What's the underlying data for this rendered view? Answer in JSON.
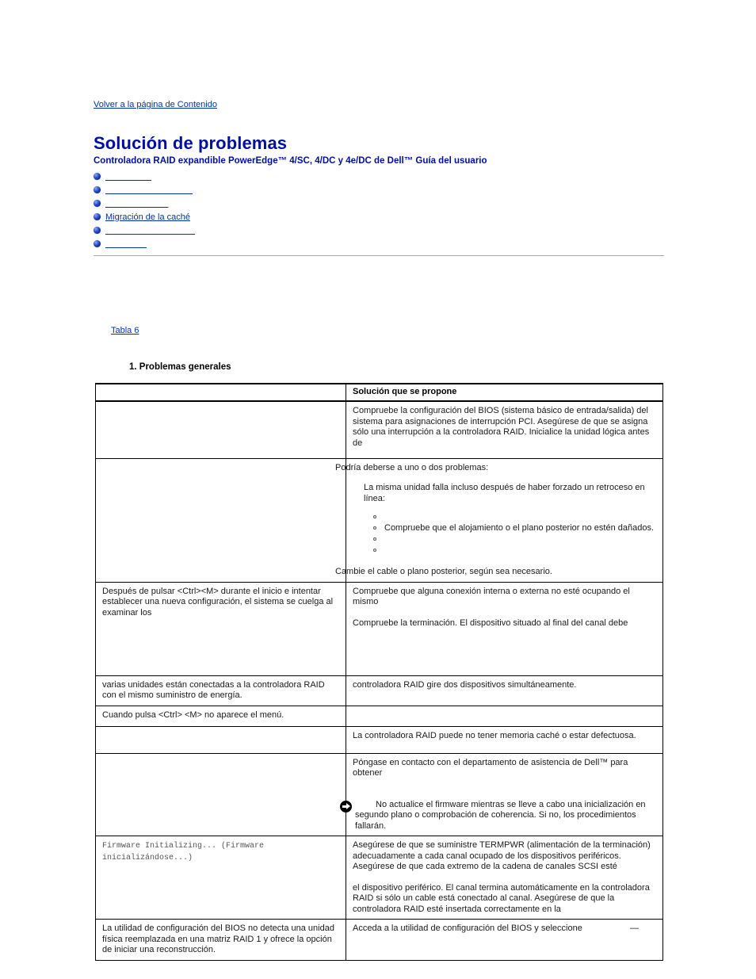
{
  "back_link": "Volver a la página de Contenido",
  "title": "Solución de problemas",
  "subtitle": "Controladora RAID expandible PowerEdge™ 4/SC, 4/DC y 4e/DC de Dell™ Guía del usuario",
  "toc": [
    {
      "label": "                   "
    },
    {
      "label": "                                    "
    },
    {
      "label": "                          "
    },
    {
      "label": "Migración de la caché"
    },
    {
      "label": "                                     "
    },
    {
      "label": "                 "
    }
  ],
  "table_ref": "Tabla 6  ",
  "table_caption": "1. Problemas generales",
  "table": {
    "headers": [
      "",
      "Solución que se propone"
    ],
    "rows": [
      {
        "problem": "",
        "solution_lead": "",
        "solution_paragraphs": [
          "Compruebe la configuración del BIOS (sistema básico de entrada/salida) del sistema para asignaciones de interrupción PCI. Asegúrese de que se asigna sólo una interrupción a la controladora RAID. Inicialice la unidad lógica antes de"
        ]
      },
      {
        "problem": "",
        "solution_lead": "Podría deberse a uno o dos problemas:",
        "sub_head": "La misma unidad falla incluso después de haber forzado un retroceso en línea:",
        "sub_items": [
          "",
          "Compruebe que el alojamiento o el plano posterior no estén dañados.",
          "",
          ""
        ],
        "solution_tail": "Cambie el cable o plano posterior, según sea necesario."
      },
      {
        "problem": "Después de pulsar <Ctrl><M> durante el inicio e intentar establecer una nueva configuración, el sistema se cuelga al examinar los",
        "solution_paragraphs": [
          "Compruebe que alguna conexión interna o externa no esté ocupando el mismo",
          "Compruebe la terminación. El dispositivo situado al final del canal debe"
        ]
      },
      {
        "problem": "varias unidades están conectadas a la controladora RAID con el mismo suministro de energía.",
        "solution_paragraphs": [
          "controladora RAID gire dos dispositivos simultáneamente."
        ]
      },
      {
        "problem": "Cuando pulsa <Ctrl> <M> no aparece el menú.",
        "solution_paragraphs": [
          ""
        ]
      },
      {
        "problem": "",
        "solution_paragraphs": [
          "La controladora RAID puede no tener memoria caché o estar defectuosa."
        ]
      },
      {
        "problem": "",
        "solution_paragraphs": [
          "Póngase en contacto con el departamento de asistencia de Dell™ para obtener"
        ],
        "notice": {
          "icon": "notice-arrow-icon",
          "text": "No actualice el firmware mientras se lleve a cabo una inicialización en segundo plano o comprobación de coherencia. Si no, los procedimientos fallarán."
        }
      },
      {
        "problem_mono": "Firmware Initializing... (Firmware inicializándose...)",
        "solution_paragraphs": [
          "Asegúrese de que se suministre TERMPWR (alimentación de la terminación) adecuadamente a cada canal ocupado de los dispositivos periféricos. Asegúrese de que cada extremo de la cadena de canales SCSI esté",
          "el dispositivo periférico. El canal termina automáticamente en la controladora RAID si sólo un cable está conectado al canal. Asegúrese de que la controladora RAID esté insertada correctamente en la"
        ]
      },
      {
        "problem": "La utilidad de configuración del BIOS no detecta una unidad física reemplazada en una matriz RAID 1 y ofrece la opción de iniciar una reconstrucción.",
        "solution_paragraphs": [
          "Acceda a la utilidad de configuración del BIOS y seleccione"
        ],
        "solution_suffix": "—"
      }
    ]
  },
  "colors": {
    "heading": "#000f9f",
    "link": "#0033aa",
    "rule": "#a8a8a8",
    "table_border": "#000000"
  }
}
